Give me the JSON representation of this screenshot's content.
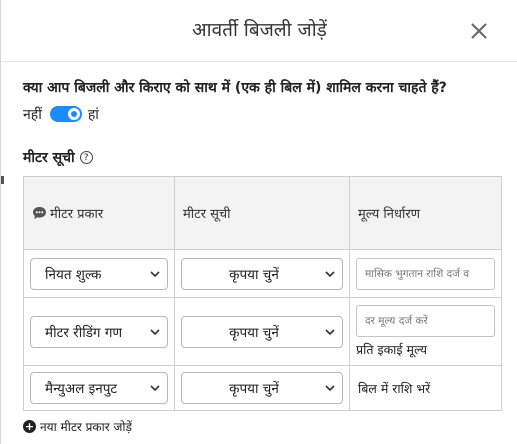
{
  "dialog": {
    "title": "आवर्ती बिजली जोड़ें",
    "close_icon": "close-icon"
  },
  "question": "क्या आप बिजली और किराए को साथ में (एक ही बिल में) शामिल करना चाहते हैं?",
  "toggle": {
    "off_label": "नहीं",
    "on_label": "हां",
    "state": "on",
    "color": "#1a8cff"
  },
  "section": {
    "title": "मीटर सूची",
    "help_icon": "help-circle-icon",
    "help_glyph": "?"
  },
  "table": {
    "headers": {
      "meter_type": "मीटर प्रकार",
      "meter_list": "मीटर सूची",
      "pricing": "मूल्य निर्धारण"
    },
    "rows": [
      {
        "meter_type": "नियत शुल्क",
        "meter_list": "कृपया चुनें",
        "pricing_placeholder": "मासिक भुगतान राशि दर्ज व",
        "pricing_label": ""
      },
      {
        "meter_type": "मीटर रीडिंग गण",
        "meter_list": "कृपया चुनें",
        "pricing_placeholder": "दर मूल्य दर्ज करें",
        "pricing_label": "प्रति इकाई मूल्य"
      },
      {
        "meter_type": "मैन्युअल इनपुट",
        "meter_list": "कृपया चुनें",
        "pricing_placeholder": "",
        "pricing_label": "बिल में राशि भरें"
      }
    ]
  },
  "add_row": {
    "label": "नया मीटर प्रकार जोड़ें",
    "icon": "plus-circle-icon",
    "glyph": "+"
  }
}
